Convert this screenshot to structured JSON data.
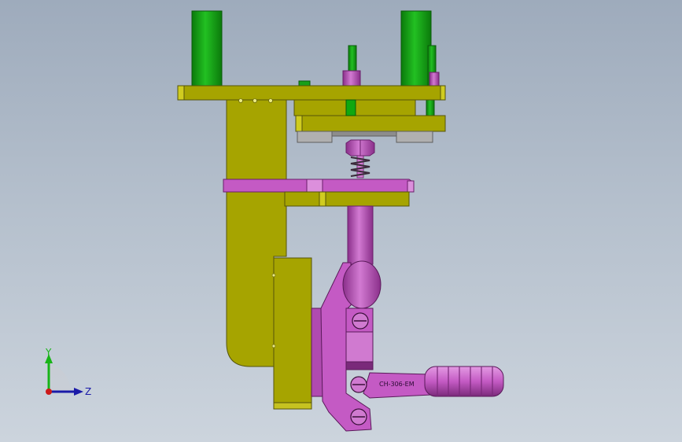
{
  "part_marking": "CH-306-EM",
  "triad": {
    "y_label": "Y",
    "z_label": "Z",
    "y_color": "#18b418",
    "z_color": "#1a1aa8",
    "origin_color": "#cc1a1a"
  },
  "colors": {
    "frame": "#a6a400",
    "frame_dark": "#7d7b00",
    "rod": "#10a810",
    "rod_dark": "#0b7a0b",
    "clamp": "#c45ac4",
    "clamp_dark": "#8a2f8a",
    "pad": "#b0b0b0",
    "background_top": "#9eabbc",
    "background_bottom": "#ccd4dd"
  }
}
